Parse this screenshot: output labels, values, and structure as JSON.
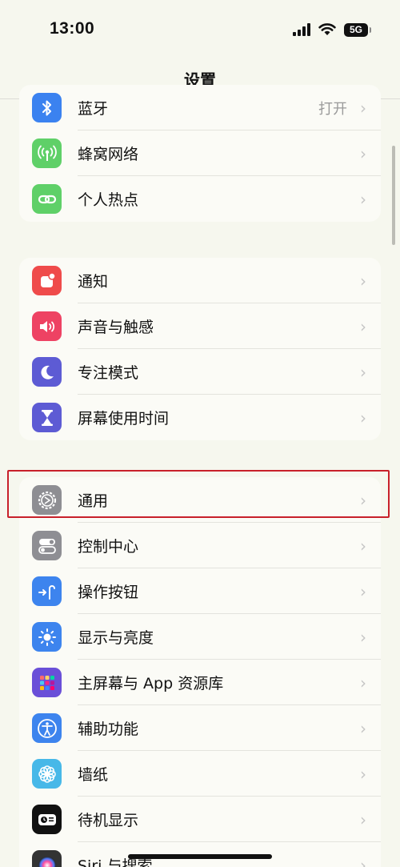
{
  "status_bar": {
    "time": "13:00",
    "network": "5G",
    "icons": [
      "signal-icon",
      "wifi-icon",
      "battery-icon"
    ]
  },
  "nav": {
    "title": "设置"
  },
  "groups": [
    {
      "items": [
        {
          "label": "蓝牙",
          "value": "打开",
          "icon": "bluetooth-icon",
          "color": "#3b82f0"
        },
        {
          "label": "蜂窝网络",
          "value": "",
          "icon": "cellular-icon",
          "color": "#5fd068"
        },
        {
          "label": "个人热点",
          "value": "",
          "icon": "hotspot-icon",
          "color": "#5fd068"
        }
      ]
    },
    {
      "items": [
        {
          "label": "通知",
          "value": "",
          "icon": "notification-icon",
          "color": "#ef4b4b"
        },
        {
          "label": "声音与触感",
          "value": "",
          "icon": "sound-icon",
          "color": "#ee4263"
        },
        {
          "label": "专注模式",
          "value": "",
          "icon": "focus-moon-icon",
          "color": "#5d5bd4"
        },
        {
          "label": "屏幕使用时间",
          "value": "",
          "icon": "screen-time-hourglass-icon",
          "color": "#5d5bd4"
        }
      ]
    },
    {
      "items": [
        {
          "label": "通用",
          "value": "",
          "icon": "gear-icon",
          "color": "#8e8e93"
        },
        {
          "label": "控制中心",
          "value": "",
          "icon": "control-center-icon",
          "color": "#8e8e93"
        },
        {
          "label": "操作按钮",
          "value": "",
          "icon": "action-button-icon",
          "color": "#3d84ee"
        },
        {
          "label": "显示与亮度",
          "value": "",
          "icon": "brightness-sun-icon",
          "color": "#3d84ee"
        },
        {
          "label": "主屏幕与 App 资源库",
          "value": "",
          "icon": "home-screen-icon",
          "color": "#6a4fd8"
        },
        {
          "label": "辅助功能",
          "value": "",
          "icon": "accessibility-icon",
          "color": "#3d84ee"
        },
        {
          "label": "墙纸",
          "value": "",
          "icon": "wallpaper-flower-icon",
          "color": "#47b8e8"
        },
        {
          "label": "待机显示",
          "value": "",
          "icon": "standby-icon",
          "color": "#111111"
        },
        {
          "label": "Siri 与搜索",
          "value": "",
          "icon": "siri-icon",
          "color": "#333333"
        }
      ]
    }
  ],
  "highlight": {
    "target": "通用",
    "color": "#c8202a"
  }
}
